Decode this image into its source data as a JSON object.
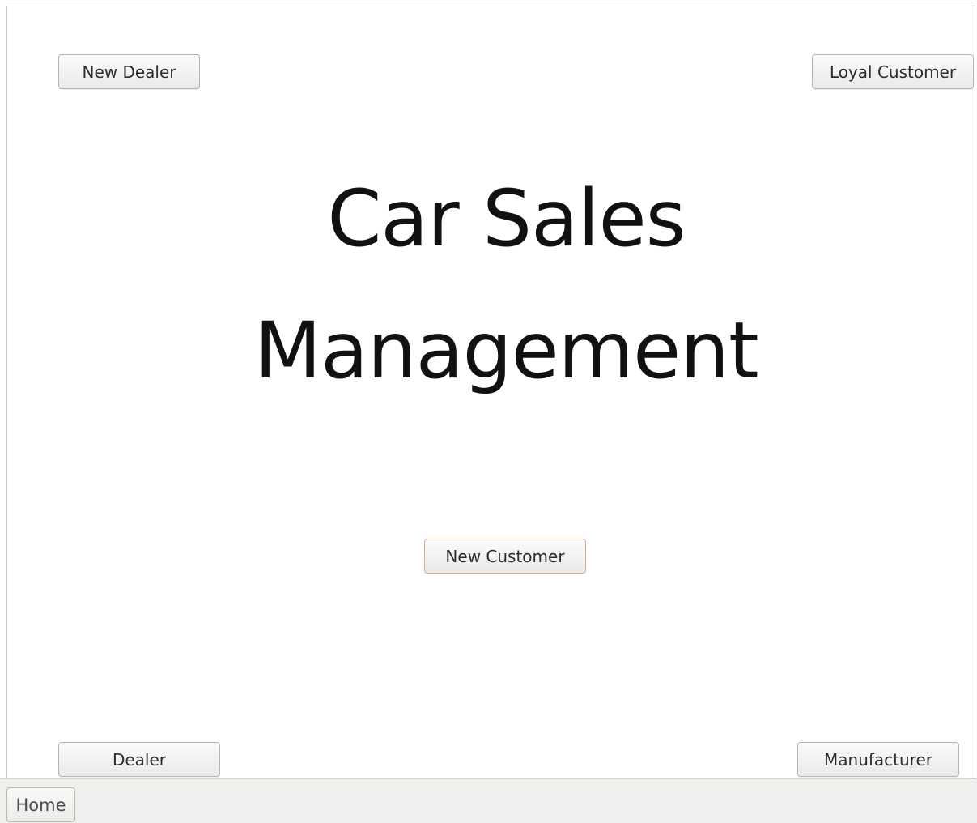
{
  "title": {
    "line1": "Car Sales",
    "line2": "Management"
  },
  "buttons": {
    "new_dealer": "New Dealer",
    "loyal_customer": "Loyal Customer",
    "new_customer": "New Customer",
    "dealer": "Dealer",
    "manufacturer": "Manufacturer"
  },
  "tabs": [
    {
      "label": "Home"
    }
  ],
  "colors": {
    "focus_border": "#e3a58b",
    "text": "#111111"
  }
}
